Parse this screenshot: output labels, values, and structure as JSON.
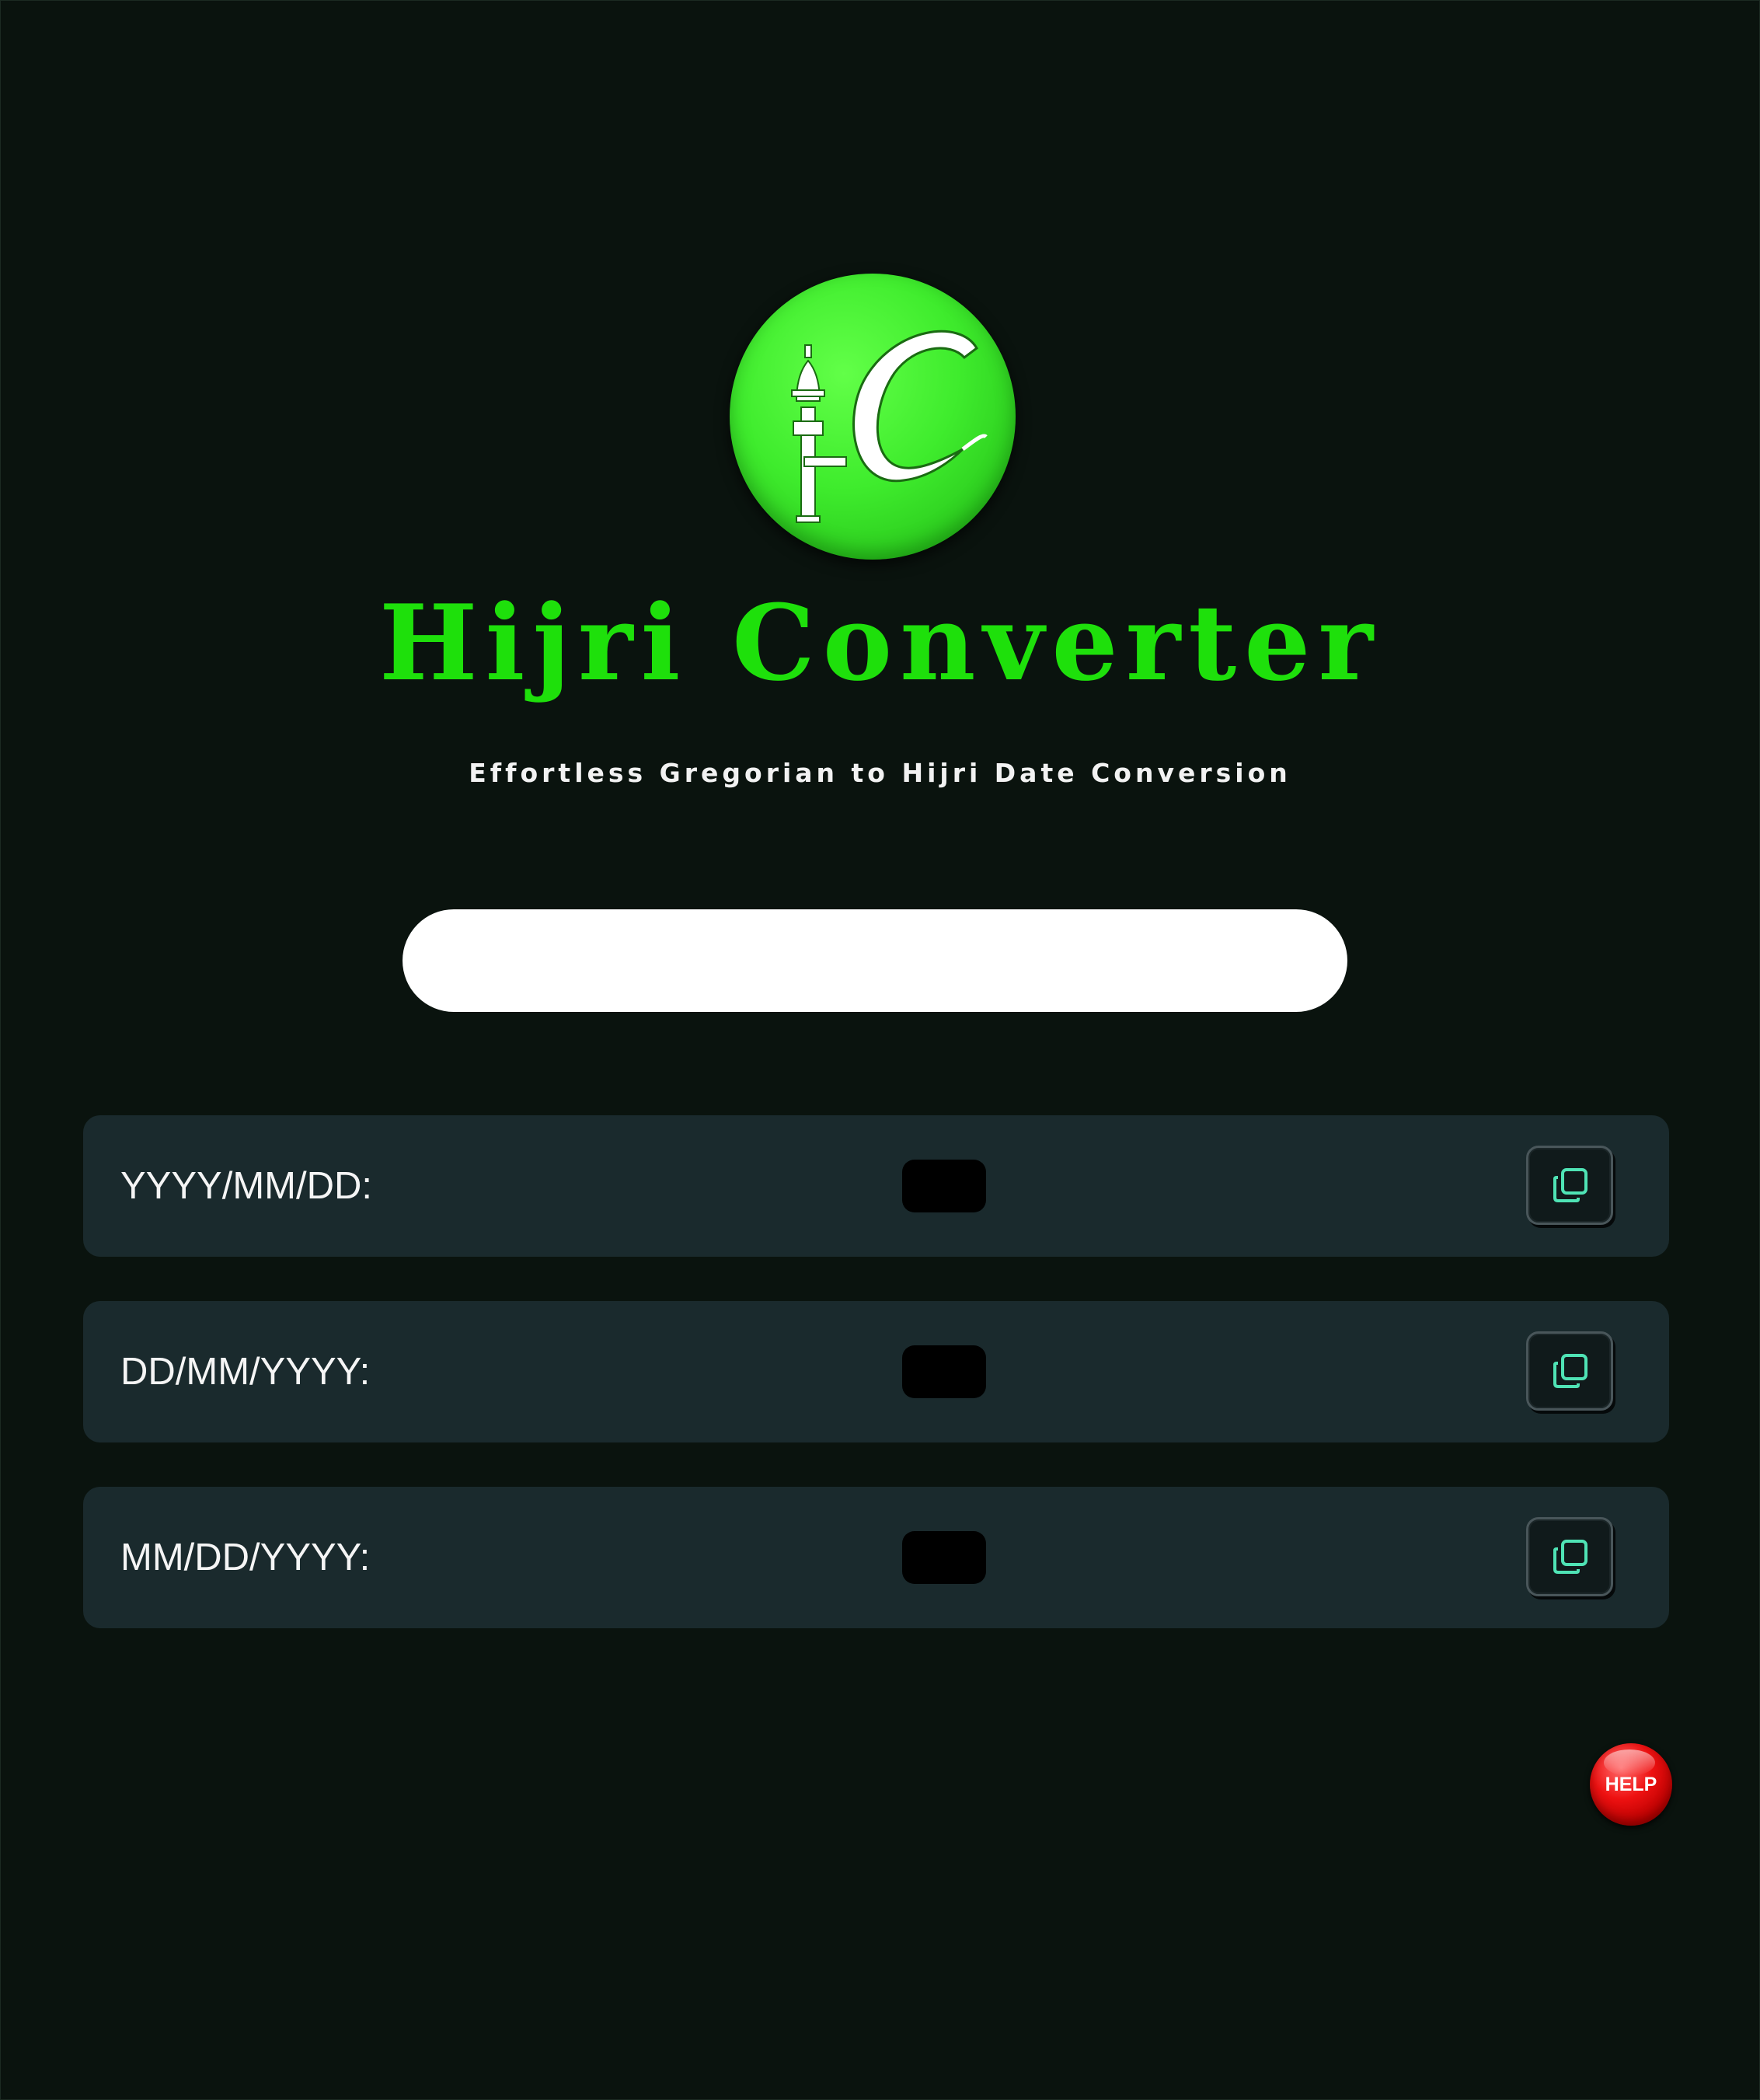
{
  "app": {
    "title": "Hijri Converter",
    "subtitle": "Effortless Gregorian to Hijri Date Conversion"
  },
  "input": {
    "value": "",
    "placeholder": ""
  },
  "results": [
    {
      "label": "YYYY/MM/DD:",
      "value": ""
    },
    {
      "label": "DD/MM/YYYY:",
      "value": ""
    },
    {
      "label": "MM/DD/YYYY:",
      "value": ""
    }
  ],
  "help": {
    "label": "HELP"
  },
  "colors": {
    "background": "#0a130e",
    "brand_green": "#1ee00b",
    "row_background": "#1a2a2d",
    "copy_icon": "#4fe3b5",
    "help_red": "#e81010"
  },
  "icons": {
    "logo": "minaret-logo-icon",
    "copy": "copy-icon"
  }
}
